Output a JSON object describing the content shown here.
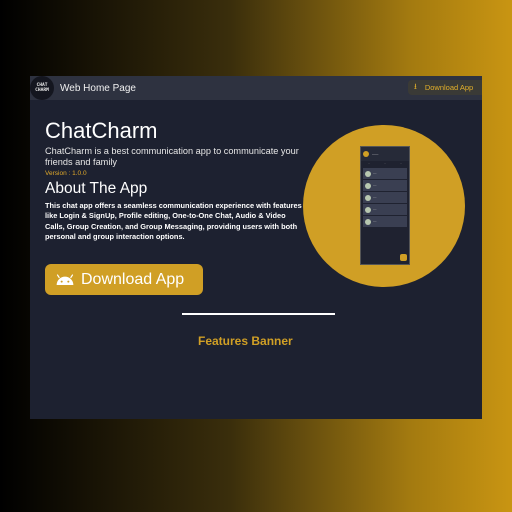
{
  "topbar": {
    "logo_line1": "CHAT",
    "logo_line2": "CHARM",
    "title": "Web Home Page",
    "download_label": "Download App"
  },
  "hero": {
    "app_name": "ChatCharm",
    "tagline": "ChatCharm is a best communication app to communicate your friends and family",
    "version": "Version : 1.0.0",
    "about_title": "About The App",
    "about_body": "This chat app offers a seamless communication experience with features like Login & SignUp, Profile editing, One-to-One Chat, Audio & Video Calls, Group Creation, and Group Messaging, providing users with both personal and group interaction options.",
    "download_label": "Download App"
  },
  "features": {
    "title": "Features Banner"
  },
  "colors": {
    "accent": "#d09f25",
    "background": "#1d2130",
    "topbar": "#2e3240"
  },
  "icons": {
    "download": "download-icon",
    "android": "android-icon"
  }
}
